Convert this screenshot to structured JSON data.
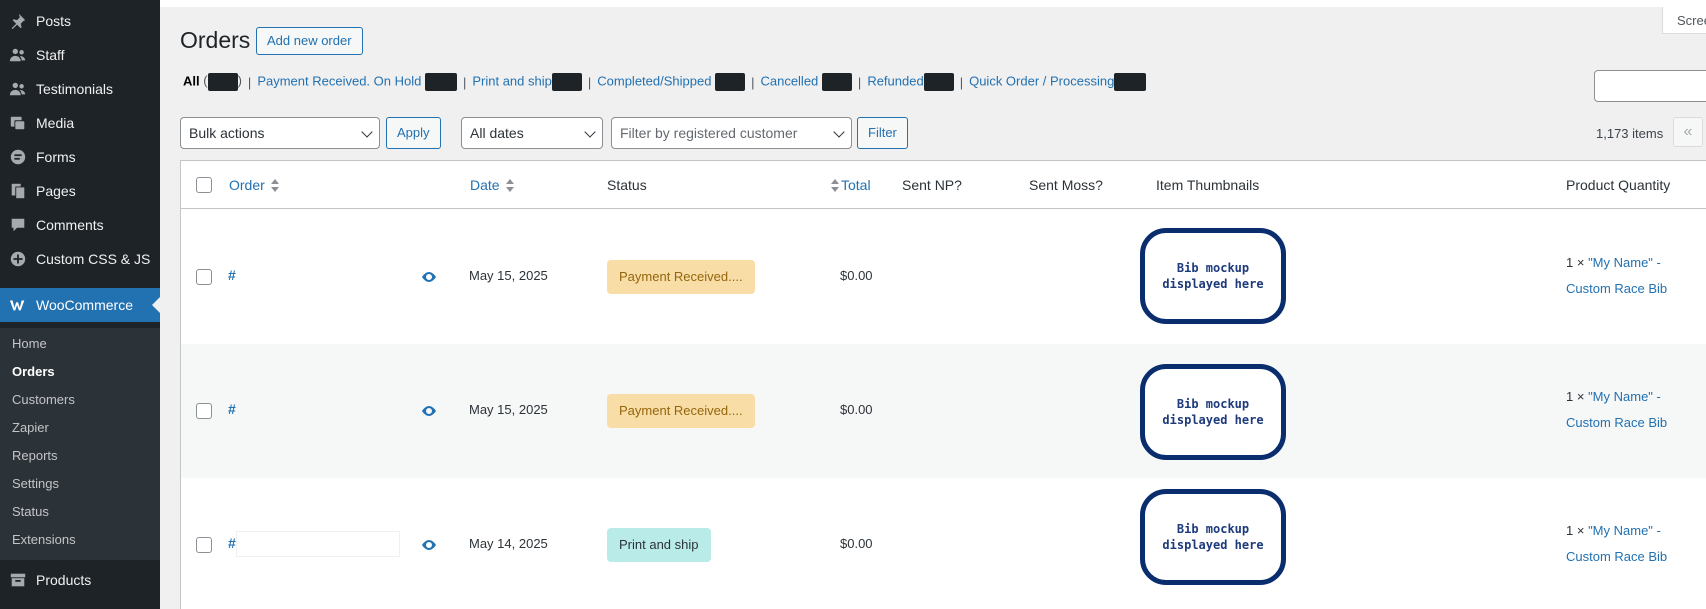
{
  "sidebar": {
    "items": [
      {
        "label": "Posts",
        "icon": "pin-icon"
      },
      {
        "label": "Staff",
        "icon": "staff-icon"
      },
      {
        "label": "Testimonials",
        "icon": "testimonials-icon"
      },
      {
        "label": "Media",
        "icon": "media-icon"
      },
      {
        "label": "Forms",
        "icon": "forms-icon"
      },
      {
        "label": "Pages",
        "icon": "pages-icon"
      },
      {
        "label": "Comments",
        "icon": "comments-icon"
      },
      {
        "label": "Custom CSS & JS",
        "icon": "plus-icon"
      },
      {
        "label": "WooCommerce",
        "icon": "woo-icon"
      }
    ],
    "submenu": [
      "Home",
      "Orders",
      "Customers",
      "Zapier",
      "Reports",
      "Settings",
      "Status",
      "Extensions"
    ],
    "products": "Products",
    "active_color": "#2271b1"
  },
  "header": {
    "title": "Orders",
    "add_button": "Add new order",
    "screen_options": "Screen Options"
  },
  "filters": {
    "all": "All",
    "views": [
      "Payment Received. On Hold",
      "Print and ship",
      "Completed/Shipped",
      "Cancelled",
      "Refunded",
      "Quick Order / Processing"
    ],
    "bulk_actions": "Bulk actions",
    "apply": "Apply",
    "dates": "All dates",
    "customer_placeholder": "Filter by registered customer",
    "filter": "Filter",
    "items_count": "1,173 items",
    "first_page": "«"
  },
  "table": {
    "columns": {
      "order": "Order",
      "date": "Date",
      "status": "Status",
      "total": "Total",
      "sent_np": "Sent NP?",
      "sent_moss": "Sent Moss?",
      "thumbnails": "Item Thumbnails",
      "quantity": "Product Quantity"
    },
    "rows": [
      {
        "order": "#",
        "date": "May 15, 2025",
        "status": "Payment Received....",
        "status_bg": "#f8dda7",
        "status_fg": "#94660c",
        "total": "$0.00",
        "thumb": "Bib mockup displayed here",
        "qty_prefix": "1 ×",
        "qty_product_1": "\"My Name\" -",
        "qty_product_2": "Custom Race Bib"
      },
      {
        "order": "#",
        "date": "May 15, 2025",
        "status": "Payment Received....",
        "status_bg": "#f8dda7",
        "status_fg": "#94660c",
        "total": "$0.00",
        "thumb": "Bib mockup displayed here",
        "qty_prefix": "1 ×",
        "qty_product_1": "\"My Name\" -",
        "qty_product_2": "Custom Race Bib"
      },
      {
        "order": "#",
        "date": "May 14, 2025",
        "status": "Print and ship",
        "status_bg": "#b9ebe9",
        "status_fg": "#2c3338",
        "total": "$0.00",
        "thumb": "Bib mockup displayed here",
        "qty_prefix": "1 ×",
        "qty_product_1": "\"My Name\" -",
        "qty_product_2": "Custom Race Bib"
      }
    ]
  }
}
